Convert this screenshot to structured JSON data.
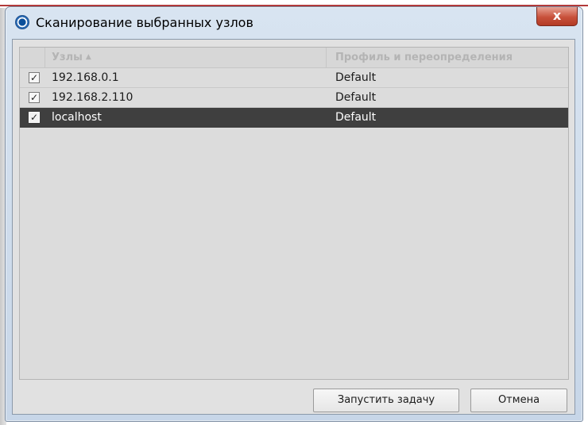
{
  "window": {
    "title": "Сканирование выбранных узлов",
    "close_label": "x"
  },
  "grid": {
    "columns": {
      "nodes": "Узлы",
      "sort_indicator": "▲",
      "profile": "Профиль и переопределения"
    },
    "rows": [
      {
        "checked": true,
        "check_glyph": "✓",
        "node": "192.168.0.1",
        "profile": "Default",
        "selected": false
      },
      {
        "checked": true,
        "check_glyph": "✓",
        "node": "192.168.2.110",
        "profile": "Default",
        "selected": false
      },
      {
        "checked": true,
        "check_glyph": "✓",
        "node": "localhost",
        "profile": "Default",
        "selected": true
      }
    ]
  },
  "buttons": {
    "run": "Запустить задачу",
    "cancel": "Отмена"
  },
  "colors": {
    "selection": "#3f3f3f",
    "close_button": "#c8513b"
  },
  "icons": {
    "title": "app-icon",
    "close": "close-icon",
    "sort": "sort-ascending-icon",
    "check": "checkmark-icon"
  }
}
